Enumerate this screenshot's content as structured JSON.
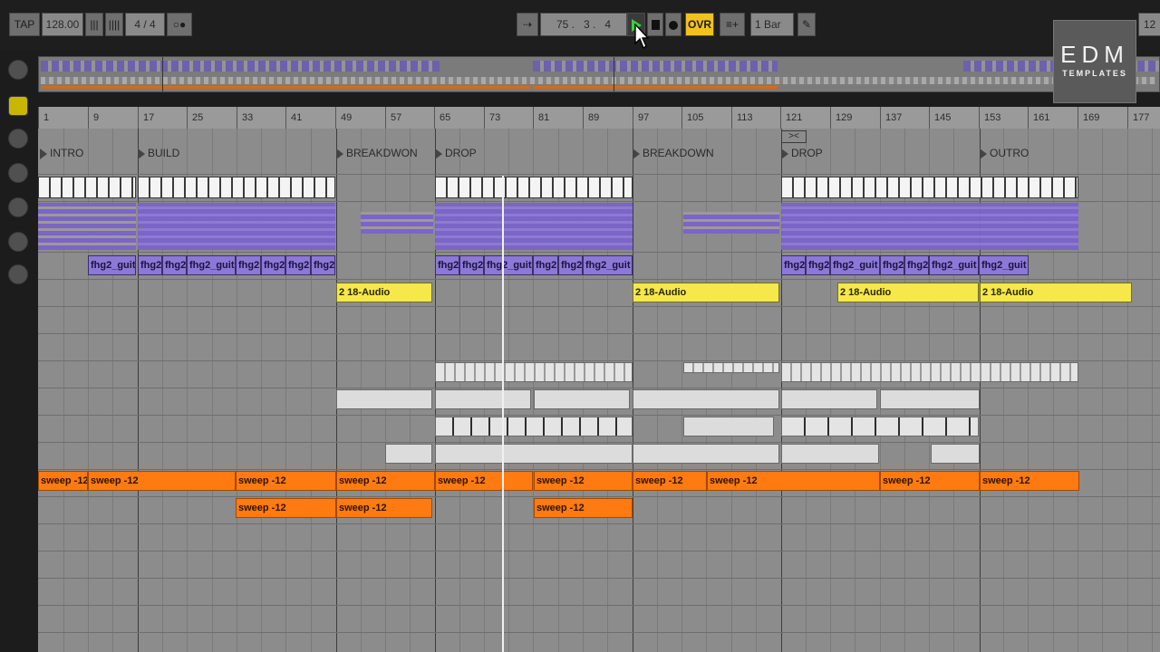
{
  "toolbar": {
    "tap": "TAP",
    "tempo": "128.00",
    "time_sig": "4 / 4",
    "position": "75 .   3 .   4",
    "ovr": "OVR",
    "quantize": "1 Bar",
    "right_value": "12"
  },
  "logo": {
    "line1": "EDM",
    "line2": "TEMPLATES"
  },
  "ruler": {
    "bars": [
      "1",
      "9",
      "17",
      "25",
      "33",
      "41",
      "49",
      "57",
      "65",
      "73",
      "81",
      "89",
      "97",
      "105",
      "113",
      "121",
      "129",
      "137",
      "145",
      "153",
      "161",
      "169",
      "177"
    ]
  },
  "locators": [
    "INTRO",
    "BUILD",
    "BREAKDWON",
    "DROP",
    "BREAKDOWN",
    "DROP",
    "OUTRO"
  ],
  "clips": {
    "guitar": [
      "fhg2_guit",
      "fhg2",
      "fhg2",
      "fhg2_guit",
      "fhg2",
      "fhg2",
      "fhg2",
      "fhg2",
      "fhg2",
      "fhg2",
      "fhg2_guit",
      "fhg2",
      "fhg2",
      "fhg2_guit",
      "fhg2",
      "fhg2",
      "fhg2_guit",
      "fhg2",
      "fhg2",
      "fhg2_guit",
      "fhg2_guit"
    ],
    "audio": [
      "2 18-Audio",
      "2 18-Audio",
      "2 18-Audio",
      "2 18-Audio"
    ],
    "sweep_row1": [
      "sweep -12",
      "sweep -12",
      "sweep -12",
      "sweep -12",
      "sweep -12",
      "sweep -12",
      "sweep -12",
      "sweep -12",
      "sweep -12",
      "sweep -12"
    ],
    "sweep_row2": [
      "sweep -12",
      "sweep -12",
      "sweep -12"
    ]
  },
  "colors": {
    "white_clip": "#f4f4f4",
    "purple_clip": "#7a63c9",
    "yellow_clip": "#f4e84a",
    "grey_clip": "#dcdcdc",
    "orange_clip": "#ff7a10",
    "ovr_button": "#f2c21b",
    "play_button": "#3ccf3c"
  }
}
